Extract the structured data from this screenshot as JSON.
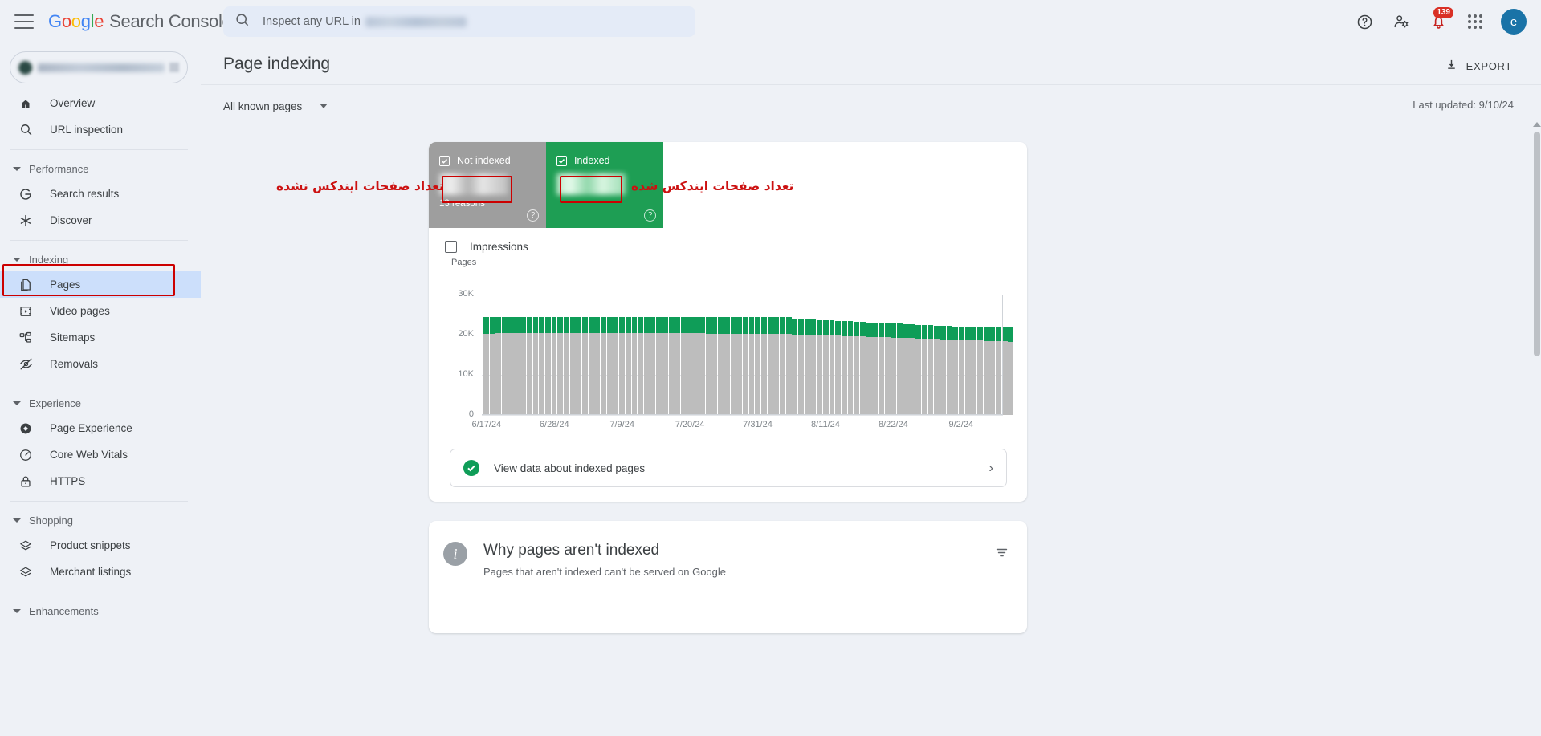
{
  "header": {
    "menu_icon": "hamburger-menu-icon",
    "brand_google": "Google",
    "brand_product": "Search Console",
    "search_prefix": "Inspect any URL in",
    "search_value_redacted": "",
    "help_icon": "help-icon",
    "user_settings_icon": "user-settings-icon",
    "notifications_icon": "notification-bell-icon",
    "notifications_badge": "139",
    "apps_icon": "apps-grid-icon",
    "avatar_initial": "e"
  },
  "sidebar": {
    "property_selector_redacted": "",
    "top_items": [
      {
        "label": "Overview",
        "icon": "home-icon"
      },
      {
        "label": "URL inspection",
        "icon": "search-icon"
      }
    ],
    "groups": [
      {
        "label": "Performance",
        "items": [
          {
            "label": "Search results",
            "icon": "google-g-icon"
          },
          {
            "label": "Discover",
            "icon": "asterisk-icon"
          }
        ]
      },
      {
        "label": "Indexing",
        "items": [
          {
            "label": "Pages",
            "icon": "pages-copy-icon",
            "active": true
          },
          {
            "label": "Video pages",
            "icon": "video-frame-icon"
          },
          {
            "label": "Sitemaps",
            "icon": "sitemap-tree-icon"
          },
          {
            "label": "Removals",
            "icon": "eye-off-icon"
          }
        ]
      },
      {
        "label": "Experience",
        "items": [
          {
            "label": "Page Experience",
            "icon": "page-experience-icon"
          },
          {
            "label": "Core Web Vitals",
            "icon": "speedometer-icon"
          },
          {
            "label": "HTTPS",
            "icon": "lock-icon"
          }
        ]
      },
      {
        "label": "Shopping",
        "items": [
          {
            "label": "Product snippets",
            "icon": "layers-diamond-icon"
          },
          {
            "label": "Merchant listings",
            "icon": "layers-diamond-icon"
          }
        ]
      },
      {
        "label": "Enhancements",
        "items": []
      }
    ]
  },
  "main": {
    "page_title": "Page indexing",
    "export_label": "EXPORT",
    "export_icon": "download-icon",
    "filter_dropdown": "All known pages",
    "last_updated": "Last updated: 9/10/24"
  },
  "summary": {
    "not_indexed": {
      "label": "Not indexed",
      "value_redacted": "",
      "sub": "13 reasons",
      "checked": true,
      "color": "#9e9e9e"
    },
    "indexed": {
      "label": "Indexed",
      "value_redacted": "",
      "sub": "",
      "checked": true,
      "color": "#1e9e54"
    },
    "impressions": {
      "label": "Impressions",
      "checked": false
    }
  },
  "annotations": {
    "left_note": "تعداد صفحات ایندکس نشده",
    "right_note": "تعداد صفحات ایندکس شده",
    "color": "#cc1111"
  },
  "chart_data": {
    "type": "bar",
    "title": "",
    "ylabel": "Pages",
    "xlabel": "",
    "ylim": [
      0,
      30000
    ],
    "yticks": [
      "0",
      "10K",
      "20K",
      "30K"
    ],
    "ytick_values": [
      0,
      10000,
      20000,
      30000
    ],
    "grid": true,
    "stacked": true,
    "legend_position": "top",
    "xtick_labels": [
      "6/17/24",
      "6/28/24",
      "7/9/24",
      "7/20/24",
      "7/31/24",
      "8/11/24",
      "8/22/24",
      "9/2/24"
    ],
    "xtick_indices": [
      0,
      11,
      22,
      33,
      44,
      55,
      66,
      77
    ],
    "series": [
      {
        "name": "Not indexed",
        "color": "#bdbdbd",
        "values": [
          20300,
          20300,
          20350,
          20350,
          20350,
          20380,
          20380,
          20380,
          20380,
          20380,
          20400,
          20400,
          20400,
          20400,
          20420,
          20420,
          20420,
          20420,
          20420,
          20400,
          20400,
          20400,
          20380,
          20380,
          20380,
          20380,
          20380,
          20360,
          20360,
          20360,
          20340,
          20340,
          20340,
          20340,
          20320,
          20320,
          20300,
          20300,
          20300,
          20280,
          20280,
          20260,
          20260,
          20260,
          20240,
          20240,
          20220,
          20200,
          20180,
          20180,
          20100,
          20050,
          20000,
          19950,
          19900,
          19850,
          19800,
          19750,
          19700,
          19650,
          19600,
          19550,
          19500,
          19450,
          19400,
          19350,
          19300,
          19250,
          19200,
          19150,
          19100,
          19050,
          19000,
          18950,
          18900,
          18850,
          18800,
          18700,
          18650,
          18600,
          18550,
          18500,
          18450,
          18400,
          18350,
          18300
        ]
      },
      {
        "name": "Indexed",
        "color": "#0f9d58",
        "values": [
          4150,
          4150,
          4100,
          4100,
          4100,
          4070,
          4070,
          4070,
          4070,
          4070,
          4050,
          4050,
          4050,
          4050,
          4030,
          4030,
          4030,
          4030,
          4030,
          4050,
          4050,
          4050,
          4070,
          4070,
          4070,
          4070,
          4070,
          4090,
          4090,
          4090,
          4110,
          4110,
          4110,
          4110,
          4130,
          4130,
          4150,
          4150,
          4150,
          4170,
          4170,
          4190,
          4190,
          4190,
          4210,
          4210,
          4230,
          4250,
          4270,
          4270,
          3900,
          3880,
          3850,
          3830,
          3800,
          3780,
          3750,
          3730,
          3700,
          3680,
          3650,
          3630,
          3600,
          3580,
          3550,
          3530,
          3500,
          3480,
          3450,
          3430,
          3400,
          3380,
          3350,
          3330,
          3300,
          3280,
          3250,
          3300,
          3320,
          3350,
          3380,
          3400,
          3420,
          3450,
          3470,
          3500
        ]
      }
    ]
  },
  "view_data": {
    "label": "View data about indexed pages",
    "status_icon": "green-check-icon",
    "chevron_icon": "chevron-right-icon"
  },
  "why_card": {
    "info_icon": "info-icon",
    "title": "Why pages aren't indexed",
    "subtitle": "Pages that aren't indexed can't be served on Google",
    "filter_icon": "filter-list-icon"
  }
}
